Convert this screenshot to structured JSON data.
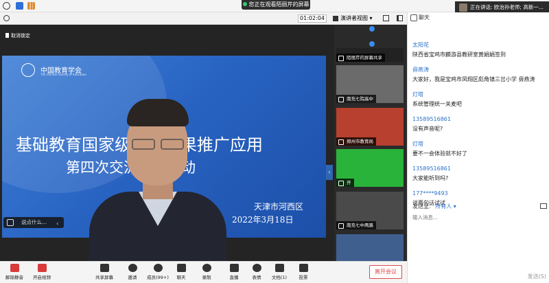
{
  "top": {
    "share_banner": "您正在观看陌丽芹的屏幕",
    "speaker_prefix": "正在讲话:",
    "speaker_names": "欧治孙老师; 高新一..."
  },
  "toolbar": {
    "timer": "01:02:04",
    "view_label": "演讲者视图"
  },
  "stage": {
    "unlock_label": "取消锁定",
    "say_placeholder": "说点什么...",
    "slide": {
      "logo_text": "中国教育学会",
      "logo_sub": "The Chinese Society of Education",
      "title_line1": "基础教育国家级教学成果推广应用",
      "title_line2": "第四次交流研讨活动",
      "organizer": "天津市河西区",
      "date": "2022年3月18日"
    }
  },
  "filmstrip": {
    "tiles": [
      {
        "label": "陌丽芹的屏幕共享",
        "bg": "#222222"
      },
      {
        "label": "南充七院高中",
        "bg": "#6b6b6b"
      },
      {
        "label": "郑州市教育局",
        "bg": "#b8402f"
      },
      {
        "label": "开",
        "bg": "#2ab33a"
      },
      {
        "label": "南充七中两路",
        "bg": "#4a4a4a"
      },
      {
        "label": "",
        "bg": "#3f5f8f"
      }
    ]
  },
  "bottombar": {
    "mute": "解除静音",
    "video": "开启视频",
    "share": "共享屏幕",
    "invite": "邀请",
    "members": "成员(99+)",
    "chat": "聊天",
    "record": "录制",
    "live": "直播",
    "emoji": "表情",
    "docs": "文档(1)",
    "vote": "投票",
    "leave": "离开会议"
  },
  "chat": {
    "title": "聊天",
    "messages": [
      {
        "who": "太阳花",
        "text": "陕西省宝鸡市麟游县教研室黄娟娟签到",
        "hl": false
      },
      {
        "who": "毋燕涛",
        "text": "大家好，我是宝鸡市凤翔区彪角镇三岔小学  毋燕涛",
        "hl": false
      },
      {
        "who": "灯塔",
        "text": "系统管理统一关麦吧",
        "hl": false
      },
      {
        "who": "13589516861",
        "text": "没有声音呢?",
        "hl": false
      },
      {
        "who": "灯塔",
        "text": "要不一会体验就不好了",
        "hl": false
      },
      {
        "who": "13589516861",
        "text": "大家能听到吗?",
        "hl": false
      },
      {
        "who": "177****9493",
        "text": "说两句话试试",
        "hl": false
      }
    ],
    "send_to_label": "发送至:",
    "send_to_value": "所有人",
    "input_placeholder": "输入消息...",
    "send_label": "发送(S)"
  }
}
